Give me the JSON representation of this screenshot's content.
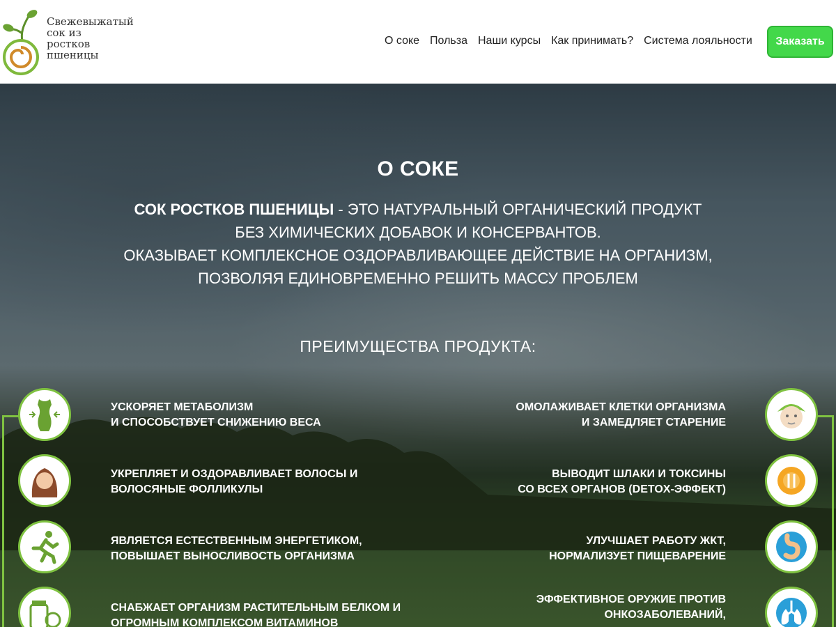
{
  "brand": {
    "lines": [
      "Свежевыжатый",
      "сок из",
      "ростков",
      "пшеницы"
    ]
  },
  "nav": {
    "items": [
      "О соке",
      "Польза",
      "Наши курсы",
      "Как принимать?",
      "Система лояльности"
    ],
    "order_button": "Заказать"
  },
  "hero": {
    "title": "О СОКЕ",
    "desc_bold": "СОК РОСТКОВ ПШЕНИЦЫ",
    "desc_line1_rest": " - ЭТО НАТУРАЛЬНЫЙ ОРГАНИЧЕСКИЙ ПРОДУКТ",
    "desc_line2": "БЕЗ ХИМИЧЕСКИХ ДОБАВОК И КОНСЕРВАНТОВ.",
    "desc_line3": "ОКАЗЫВАЕТ КОМПЛЕКСНОЕ ОЗДОРАВЛИВАЮЩЕЕ ДЕЙСТВИЕ НА ОРГАНИЗМ,",
    "desc_line4": "ПОЗВОЛЯЯ ЕДИНОВРЕМЕННО РЕШИТЬ МАССУ ПРОБЛЕМ",
    "advantages_title": "ПРЕИМУЩЕСТВА ПРОДУКТА:"
  },
  "benefits_left": [
    {
      "icon": "body-figure-icon",
      "line1": "УСКОРЯЕТ МЕТАБОЛИЗМ",
      "line2": "И СПОСОБСТВУЕТ СНИЖЕНИЮ ВЕСА"
    },
    {
      "icon": "woman-hair-icon",
      "line1": "УКРЕПЛЯЕТ И ОЗДОРАВЛИВАЕТ ВОЛОСЫ И",
      "line2": "ВОЛОСЯНЫЕ ФОЛЛИКУЛЫ"
    },
    {
      "icon": "running-man-icon",
      "line1": "ЯВЛЯЕТСЯ ЕСТЕСТВЕННЫМ ЭНЕРГЕТИКОМ,",
      "line2": "ПОВЫШАЕТ ВЫНОСЛИВОСТЬ ОРГАНИЗМА"
    },
    {
      "icon": "vitamins-icon",
      "line1": "СНАБЖАЕТ ОРГАНИЗМ РАСТИТЕЛЬНЫМ БЕЛКОМ И",
      "line2": "ОГРОМНЫМ КОМПЛЕКСОМ ВИТАМИНОВ"
    }
  ],
  "benefits_right": [
    {
      "icon": "face-mask-icon",
      "line1": "ОМОЛАЖИВАЕТ КЛЕТКИ ОРГАНИЗМА",
      "line2": "И ЗАМЕДЛЯЕТ СТАРЕНИЕ"
    },
    {
      "icon": "plate-cutlery-icon",
      "line1": "ВЫВОДИТ ШЛАКИ И ТОКСИНЫ",
      "line2": "СО ВСЕХ ОРГАНОВ (DETOX-ЭФФЕКТ)"
    },
    {
      "icon": "stomach-icon",
      "line1": "УЛУЧШАЕТ РАБОТУ ЖКТ,",
      "line2": "НОРМАЛИЗУЕТ ПИЩЕВАРЕНИЕ"
    },
    {
      "icon": "lungs-icon",
      "line1": "ЭФФЕКТИВНОЕ ОРУЖИЕ ПРОТИВ",
      "line2": "ОНКОЗАБОЛЕВАНИЙ,"
    }
  ],
  "colors": {
    "accent_green": "#7fc241",
    "button_green": "#43d84a"
  }
}
